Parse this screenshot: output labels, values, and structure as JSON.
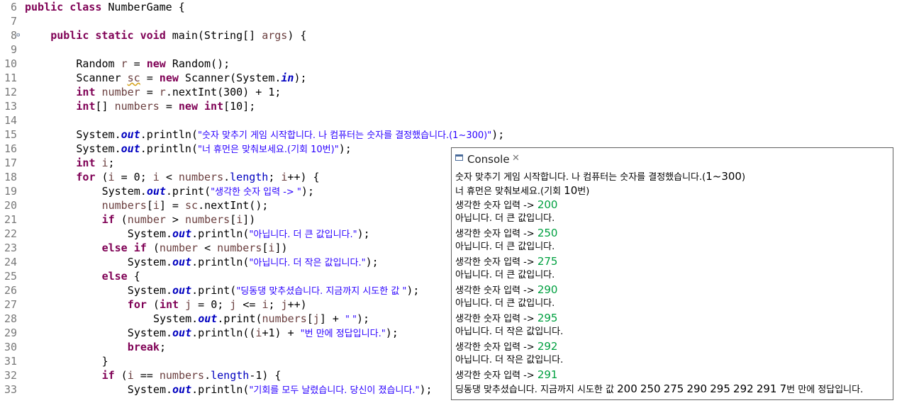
{
  "editor": {
    "lines": [
      {
        "n": "6",
        "t": "public class NumberGame {"
      },
      {
        "n": "7",
        "t": ""
      },
      {
        "n": "8",
        "t": "public static void main(String[] args) {"
      },
      {
        "n": "9",
        "t": ""
      },
      {
        "n": "10",
        "t": "Random r = new Random();"
      },
      {
        "n": "11",
        "t": "Scanner sc = new Scanner(System.in);"
      },
      {
        "n": "12",
        "t": "int number = r.nextInt(300) + 1;"
      },
      {
        "n": "13",
        "t": "int[] numbers = new int[10];"
      },
      {
        "n": "14",
        "t": ""
      },
      {
        "n": "15",
        "t": "System.out.println(\"숫자 맞추기 게임 시작합니다. 나 컴퓨터는 숫자를 결정했습니다.(1~300)\");"
      },
      {
        "n": "16",
        "t": "System.out.println(\"너 휴먼은 맞춰보세요.(기회 10번)\");"
      },
      {
        "n": "17",
        "t": "int i;"
      },
      {
        "n": "18",
        "t": "for (i = 0; i < numbers.length; i++) {"
      },
      {
        "n": "19",
        "t": "System.out.print(\"생각한 숫자 입력 -> \");"
      },
      {
        "n": "20",
        "t": "numbers[i] = sc.nextInt();"
      },
      {
        "n": "21",
        "t": "if (number > numbers[i])"
      },
      {
        "n": "22",
        "t": "System.out.println(\"아닙니다. 더 큰 값입니다.\");"
      },
      {
        "n": "23",
        "t": "else if (number < numbers[i])"
      },
      {
        "n": "24",
        "t": "System.out.println(\"아닙니다. 더 작은 값입니다.\");"
      },
      {
        "n": "25",
        "t": "else {"
      },
      {
        "n": "26",
        "t": "System.out.print(\"딩동댕 맞추셨습니다. 지금까지 시도한 값 \");"
      },
      {
        "n": "27",
        "t": "for (int j = 0; j <= i; j++)"
      },
      {
        "n": "28",
        "t": "System.out.print(numbers[j] + \" \");"
      },
      {
        "n": "29",
        "t": "System.out.println((i+1) + \"번 만에 정답입니다.\");"
      },
      {
        "n": "30",
        "t": "break;"
      },
      {
        "n": "31",
        "t": "}"
      },
      {
        "n": "32",
        "t": "if (i == numbers.length-1) {"
      },
      {
        "n": "33",
        "t": "System.out.println(\"기회를 모두 날렸습니다. 당신이 졌습니다.\");"
      }
    ]
  },
  "console": {
    "tab_label": "Console",
    "close_glyph": "✕",
    "lines": [
      {
        "text": "숫자 맞추기 게임 시작합니다. 나 컴퓨터는 숫자를 결정했습니다.(1~300)"
      },
      {
        "text": "너 휴먼은 맞춰보세요.(기회 10번)"
      },
      {
        "text": "생각한 숫자 입력 -> ",
        "input": "200"
      },
      {
        "text": "아닙니다. 더 큰 값입니다."
      },
      {
        "text": "생각한 숫자 입력 -> ",
        "input": "250"
      },
      {
        "text": "아닙니다. 더 큰 값입니다."
      },
      {
        "text": "생각한 숫자 입력 -> ",
        "input": "275"
      },
      {
        "text": "아닙니다. 더 큰 값입니다."
      },
      {
        "text": "생각한 숫자 입력 -> ",
        "input": "290"
      },
      {
        "text": "아닙니다. 더 큰 값입니다."
      },
      {
        "text": "생각한 숫자 입력 -> ",
        "input": "295"
      },
      {
        "text": "아닙니다. 더 작은 값입니다."
      },
      {
        "text": "생각한 숫자 입력 -> ",
        "input": "292"
      },
      {
        "text": "아닙니다. 더 작은 값입니다."
      },
      {
        "text": "생각한 숫자 입력 -> ",
        "input": "291"
      },
      {
        "text": "딩동댕 맞추셨습니다. 지금까지 시도한 값 200 250 275 290 295 292 291 7번 만에 정답입니다."
      }
    ]
  },
  "colors": {
    "keyword": "#7f0055",
    "string": "#2a00ff",
    "field": "#0000c0",
    "console_input": "#00a040"
  }
}
